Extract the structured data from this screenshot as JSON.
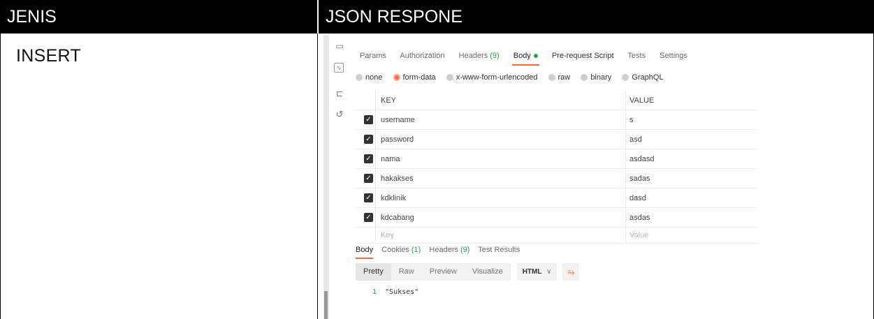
{
  "table": {
    "col1_header": "JENIS",
    "col2_header": "JSON RESPONE",
    "row_label": "INSERT"
  },
  "request_tabs": {
    "params": "Params",
    "authorization": "Authorization",
    "headers": "Headers",
    "headers_count": "(9)",
    "body": "Body",
    "pre_request": "Pre-request Script",
    "tests": "Tests",
    "settings": "Settings"
  },
  "body_modes": [
    "none",
    "form-data",
    "x-www-form-urlencoded",
    "raw",
    "binary",
    "GraphQL"
  ],
  "body_mode_selected": "form-data",
  "kv_table": {
    "key_header": "KEY",
    "value_header": "VALUE",
    "rows": [
      {
        "key": "username",
        "value": "s"
      },
      {
        "key": "password",
        "value": "asd"
      },
      {
        "key": "nama",
        "value": "asdasd"
      },
      {
        "key": "hakakses",
        "value": "sadas"
      },
      {
        "key": "kdklinik",
        "value": "dasd"
      },
      {
        "key": "kdcabang",
        "value": "asdas"
      }
    ],
    "key_placeholder": "Key",
    "value_placeholder": "Value"
  },
  "response_tabs": {
    "body": "Body",
    "cookies": "Cookies",
    "cookies_count": "(1)",
    "headers": "Headers",
    "headers_count": "(9)",
    "test_results": "Test Results"
  },
  "view_modes": {
    "pretty": "Pretty",
    "raw": "Raw",
    "preview": "Preview",
    "visualize": "Visualize",
    "format": "HTML",
    "format_chevron": "∨"
  },
  "code": {
    "line_number": "1",
    "content": "\"Sukses\""
  },
  "colors": {
    "accent": "#f26b3a",
    "green": "#27a745"
  }
}
